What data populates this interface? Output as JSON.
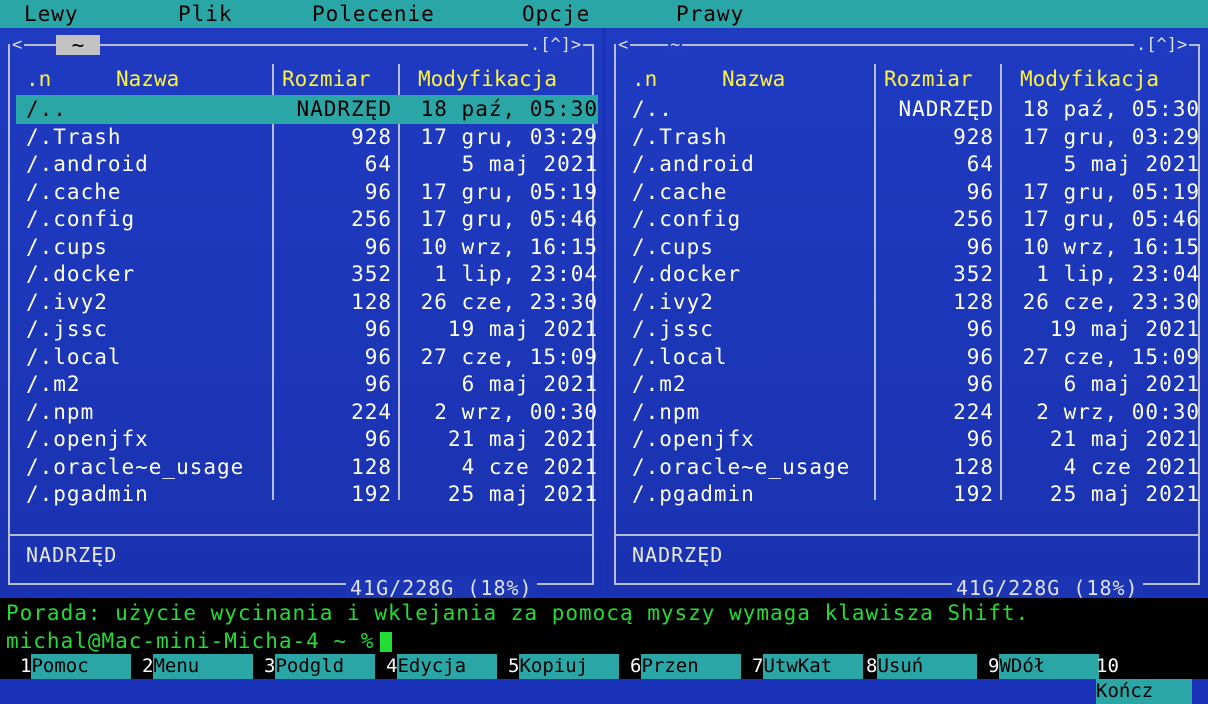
{
  "menu": [
    "Lewy",
    "Plik",
    "Polecenie",
    "Opcje",
    "Prawy"
  ],
  "header": {
    "tilde": "~",
    "arrows": ".[^]>",
    "left_corner": "<"
  },
  "columns": {
    "n": ".n",
    "name": "Nazwa",
    "size": "Rozmiar",
    "mod": "Modyfikacja"
  },
  "left_rows": [
    {
      "name": "/..",
      "size": "NADRZĘD",
      "mod": "18 paź, 05:30"
    },
    {
      "name": "/.Trash",
      "size": "928",
      "mod": "17 gru, 03:29"
    },
    {
      "name": "/.android",
      "size": "64",
      "mod": "5 maj 2021"
    },
    {
      "name": "/.cache",
      "size": "96",
      "mod": "17 gru, 05:19"
    },
    {
      "name": "/.config",
      "size": "256",
      "mod": "17 gru, 05:46"
    },
    {
      "name": "/.cups",
      "size": "96",
      "mod": "10 wrz, 16:15"
    },
    {
      "name": "/.docker",
      "size": "352",
      "mod": "1 lip, 23:04"
    },
    {
      "name": "/.ivy2",
      "size": "128",
      "mod": "26 cze, 23:30"
    },
    {
      "name": "/.jssc",
      "size": "96",
      "mod": "19 maj 2021"
    },
    {
      "name": "/.local",
      "size": "96",
      "mod": "27 cze, 15:09"
    },
    {
      "name": "/.m2",
      "size": "96",
      "mod": "6 maj 2021"
    },
    {
      "name": "/.npm",
      "size": "224",
      "mod": "2 wrz, 00:30"
    },
    {
      "name": "/.openjfx",
      "size": "96",
      "mod": "21 maj 2021"
    },
    {
      "name": "/.oracle~e_usage",
      "size": "128",
      "mod": "4 cze 2021"
    },
    {
      "name": "/.pgadmin",
      "size": "192",
      "mod": "25 maj 2021"
    }
  ],
  "right_rows": [
    {
      "name": "/..",
      "size": "NADRZĘD",
      "mod": "18 paź, 05:30"
    },
    {
      "name": "/.Trash",
      "size": "928",
      "mod": "17 gru, 03:29"
    },
    {
      "name": "/.android",
      "size": "64",
      "mod": "5 maj 2021"
    },
    {
      "name": "/.cache",
      "size": "96",
      "mod": "17 gru, 05:19"
    },
    {
      "name": "/.config",
      "size": "256",
      "mod": "17 gru, 05:46"
    },
    {
      "name": "/.cups",
      "size": "96",
      "mod": "10 wrz, 16:15"
    },
    {
      "name": "/.docker",
      "size": "352",
      "mod": "1 lip, 23:04"
    },
    {
      "name": "/.ivy2",
      "size": "128",
      "mod": "26 cze, 23:30"
    },
    {
      "name": "/.jssc",
      "size": "96",
      "mod": "19 maj 2021"
    },
    {
      "name": "/.local",
      "size": "96",
      "mod": "27 cze, 15:09"
    },
    {
      "name": "/.m2",
      "size": "96",
      "mod": "6 maj 2021"
    },
    {
      "name": "/.npm",
      "size": "224",
      "mod": "2 wrz, 00:30"
    },
    {
      "name": "/.openjfx",
      "size": "96",
      "mod": "21 maj 2021"
    },
    {
      "name": "/.oracle~e_usage",
      "size": "128",
      "mod": "4 cze 2021"
    },
    {
      "name": "/.pgadmin",
      "size": "192",
      "mod": "25 maj 2021"
    }
  ],
  "left_status": "NADRZĘD",
  "right_status": "NADRZĘD",
  "disk": "41G/228G (18%)",
  "hint": "Porada: użycie wycinania i wklejania za pomocą myszy wymaga klawisza Shift.",
  "prompt": "michal@Mac-mini-Micha-4 ~ %",
  "fkeys": [
    {
      "num": "1",
      "label": "Pomoc"
    },
    {
      "num": "2",
      "label": "Menu"
    },
    {
      "num": "3",
      "label": "Podgld"
    },
    {
      "num": "4",
      "label": "Edycja"
    },
    {
      "num": "5",
      "label": "Kopiuj"
    },
    {
      "num": "6",
      "label": "Przen"
    },
    {
      "num": "7",
      "label": "UtwKat"
    },
    {
      "num": "8",
      "label": "Usuń"
    },
    {
      "num": "9",
      "label": "WDół"
    },
    {
      "num": "10",
      "label": "Kończ"
    }
  ],
  "colors": {
    "panel": "#1a32b8",
    "selection": "#2ba6a6",
    "header_text": "#fff23d",
    "terminal_text": "#22dd33"
  }
}
